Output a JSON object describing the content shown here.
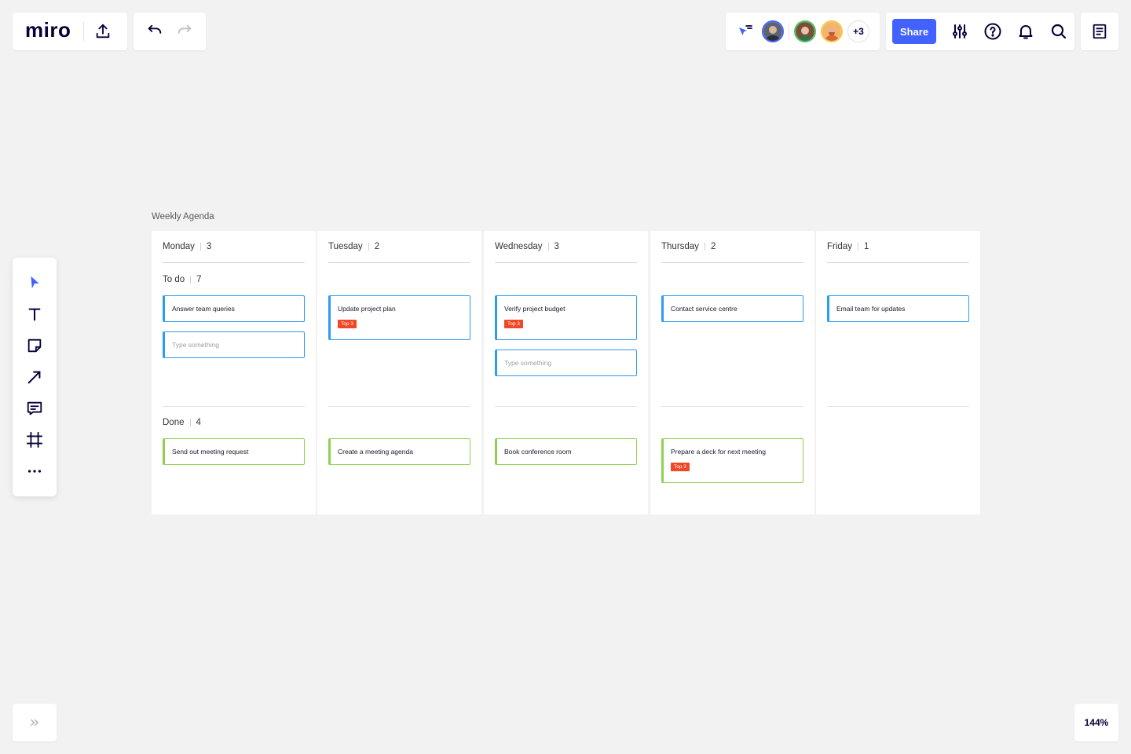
{
  "app": {
    "logo": "miro"
  },
  "collaborators": {
    "more_count": "+3"
  },
  "toolbar": {
    "share_label": "Share"
  },
  "zoom": {
    "level": "144%"
  },
  "board": {
    "title": "Weekly Agenda",
    "columns": [
      {
        "day": "Monday",
        "count": "3",
        "todo_label": "To do",
        "todo_count": "7",
        "done_label": "Done",
        "done_count": "4",
        "todo": [
          {
            "text": "Answer team queries"
          },
          {
            "text": "Type something",
            "placeholder": true
          }
        ],
        "done": [
          {
            "text": "Send out meeting request"
          }
        ]
      },
      {
        "day": "Tuesday",
        "count": "2",
        "todo": [
          {
            "text": "Update project plan",
            "tag": "Top 3"
          }
        ],
        "done": [
          {
            "text": "Create a meeting agenda"
          }
        ]
      },
      {
        "day": "Wednesday",
        "count": "3",
        "todo": [
          {
            "text": "Verify project budget",
            "tag": "Top 3"
          },
          {
            "text": "Type something",
            "placeholder": true
          }
        ],
        "done": [
          {
            "text": "Book conference room"
          }
        ]
      },
      {
        "day": "Thursday",
        "count": "2",
        "todo": [
          {
            "text": "Contact service centre"
          }
        ],
        "done": [
          {
            "text": "Prepare a deck for next meeting",
            "tag": "Top 3"
          }
        ]
      },
      {
        "day": "Friday",
        "count": "1",
        "todo": [
          {
            "text": "Email team for updates"
          }
        ],
        "done": []
      }
    ]
  },
  "colors": {
    "accent": "#4262ff",
    "todo_border": "#2d9bf0",
    "done_border": "#8fd14f",
    "tag": "#f24726"
  },
  "icons": {
    "upload": "upload-icon",
    "undo": "undo-icon",
    "redo": "redo-icon",
    "cursor": "cursor-icon",
    "settings": "sliders-icon",
    "help": "help-icon",
    "notifications": "bell-icon",
    "search": "search-icon",
    "notes": "notes-icon"
  }
}
